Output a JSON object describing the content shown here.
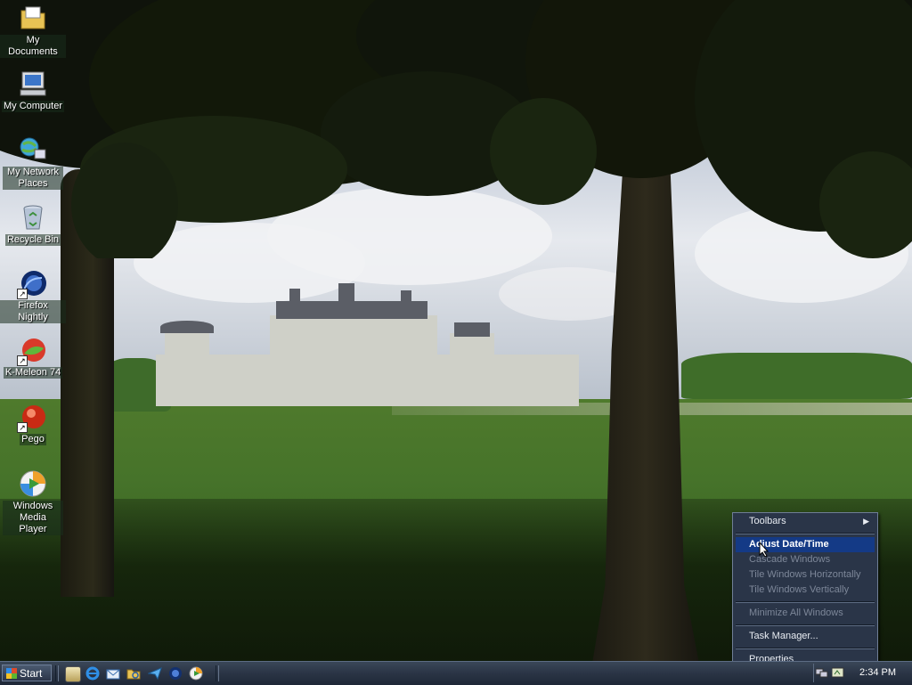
{
  "desktop": {
    "icons": [
      {
        "label": "My Documents",
        "icon": "folder-documents-icon"
      },
      {
        "label": "My Computer",
        "icon": "computer-icon"
      },
      {
        "label": "My Network Places",
        "icon": "network-icon"
      },
      {
        "label": "Recycle Bin",
        "icon": "recycle-bin-icon"
      },
      {
        "label": "Firefox Nightly",
        "icon": "firefox-nightly-icon"
      },
      {
        "label": "K-Meleon 74",
        "icon": "kmeleon-icon"
      },
      {
        "label": "Pego",
        "icon": "pego-icon"
      },
      {
        "label": "Windows Media Player",
        "icon": "media-player-icon"
      }
    ]
  },
  "taskbar": {
    "start_label": "Start",
    "quick_launch": [
      "show-desktop-icon",
      "internet-explorer-icon",
      "outlook-express-icon",
      "explorer-icon",
      "send-icon",
      "firefox-icon",
      "media-player-icon"
    ],
    "clock": "2:34 PM"
  },
  "context_menu": {
    "items": [
      {
        "label": "Toolbars",
        "enabled": true,
        "submenu": true
      },
      {
        "label": "Adjust Date/Time",
        "enabled": true,
        "highlighted": true
      },
      {
        "label": "Cascade Windows",
        "enabled": false
      },
      {
        "label": "Tile Windows Horizontally",
        "enabled": false
      },
      {
        "label": "Tile Windows Vertically",
        "enabled": false
      },
      {
        "label": "Minimize All Windows",
        "enabled": false
      },
      {
        "label": "Task Manager...",
        "enabled": true
      },
      {
        "label": "Properties",
        "enabled": true
      }
    ]
  }
}
